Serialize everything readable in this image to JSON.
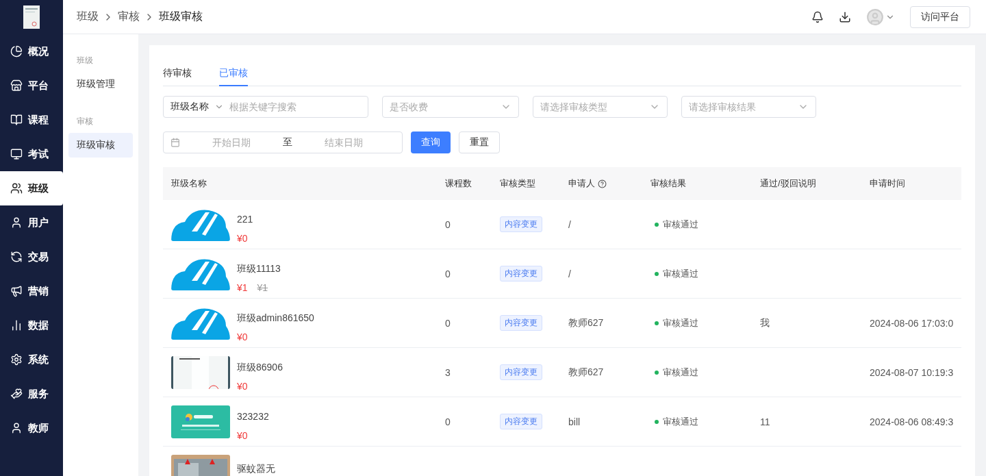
{
  "sidebar": {
    "items": [
      {
        "label": "概况",
        "selected": false
      },
      {
        "label": "平台",
        "selected": false
      },
      {
        "label": "课程",
        "selected": false
      },
      {
        "label": "考试",
        "selected": false
      },
      {
        "label": "班级",
        "selected": true
      },
      {
        "label": "用户",
        "selected": false
      },
      {
        "label": "交易",
        "selected": false
      },
      {
        "label": "营销",
        "selected": false
      },
      {
        "label": "数据",
        "selected": false
      },
      {
        "label": "系统",
        "selected": false
      },
      {
        "label": "服务",
        "selected": false
      },
      {
        "label": "教师",
        "selected": false
      }
    ]
  },
  "breadcrumb": [
    "班级",
    "审核",
    "班级审核"
  ],
  "header": {
    "visit_button": "访问平台"
  },
  "subnav": [
    {
      "title": "班级",
      "items": [
        {
          "label": "班级管理",
          "selected": false
        }
      ]
    },
    {
      "title": "审核",
      "items": [
        {
          "label": "班级审核",
          "selected": true
        }
      ]
    }
  ],
  "tabs": [
    {
      "label": "待审核",
      "selected": false
    },
    {
      "label": "已审核",
      "selected": true
    }
  ],
  "filters": {
    "search": {
      "field": "班级名称",
      "placeholder": "根据关键字搜索"
    },
    "selects": [
      {
        "placeholder": "是否收费"
      },
      {
        "placeholder": "请选择审核类型"
      },
      {
        "placeholder": "请选择审核结果"
      }
    ],
    "date_range": {
      "start_placeholder": "开始日期",
      "separator": "至",
      "end_placeholder": "结束日期"
    },
    "query_button": "查询",
    "reset_button": "重置"
  },
  "table": {
    "columns": [
      {
        "label": "班级名称"
      },
      {
        "label": "课程数"
      },
      {
        "label": "审核类型"
      },
      {
        "label": "申请人",
        "help": true
      },
      {
        "label": "审核结果"
      },
      {
        "label": "通过/驳回说明"
      },
      {
        "label": "申请时间"
      }
    ],
    "rows": [
      {
        "name": "221",
        "price": "¥0",
        "courses": "0",
        "audit_type": "内容变更",
        "applicant": "/",
        "result": {
          "label": "审核通过",
          "color": "#22b35e"
        }
      },
      {
        "name": "班级11113",
        "price": "¥1",
        "original_price": "¥1",
        "courses": "0",
        "audit_type": "内容变更",
        "applicant": "/",
        "result": {
          "label": "审核通过",
          "color": "#22b35e"
        }
      },
      {
        "name": "班级admin861650",
        "price": "¥0",
        "courses": "0",
        "audit_type": "内容变更",
        "applicant": "教师627",
        "result": {
          "label": "审核通过",
          "color": "#22b35e"
        },
        "remark": "我",
        "time": "2024-08-06 17:03:0"
      },
      {
        "name": "班级86906",
        "price": "¥0",
        "courses": "3",
        "audit_type": "内容变更",
        "applicant": "教师627",
        "result": {
          "label": "审核通过",
          "color": "#22b35e"
        },
        "time": "2024-08-07 10:19:3"
      },
      {
        "name": "323232",
        "price": "¥0",
        "courses": "0",
        "audit_type": "内容变更",
        "applicant": "bill",
        "result": {
          "label": "审核通过",
          "color": "#22b35e"
        },
        "remark": "11",
        "time": "2024-08-06 08:49:3"
      },
      {
        "name": "驱蚊器无"
      }
    ]
  }
}
